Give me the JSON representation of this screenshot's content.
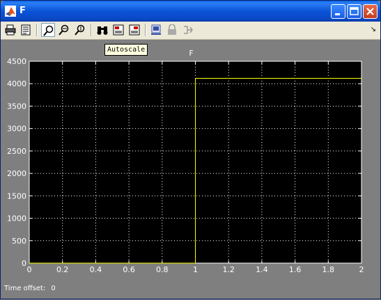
{
  "window": {
    "title": "F"
  },
  "toolbar": {
    "tooltip": "Autoscale",
    "buttons": [
      "print-icon",
      "parameters-icon",
      "zoom-icon",
      "zoom-x-icon",
      "zoom-y-icon",
      "autoscale-icon",
      "save-axes-icon",
      "restore-axes-icon",
      "float-icon",
      "lock-icon",
      "signal-selection-icon"
    ]
  },
  "chart_data": {
    "type": "line",
    "title": "F",
    "xlabel": "",
    "ylabel": "",
    "xlim": [
      0,
      2
    ],
    "ylim": [
      0,
      4500
    ],
    "x_ticks": [
      "0",
      "0.2",
      "0.4",
      "0.6",
      "0.8",
      "1",
      "1.2",
      "1.4",
      "1.6",
      "1.8",
      "2"
    ],
    "y_ticks": [
      "0",
      "500",
      "1000",
      "1500",
      "2000",
      "2500",
      "3000",
      "3500",
      "4000",
      "4500"
    ],
    "grid": true,
    "series": [
      {
        "x": [
          0,
          1,
          1,
          2
        ],
        "y": [
          0,
          0,
          4120,
          4120
        ],
        "color": "#ffff00"
      }
    ],
    "colors": {
      "axes_background": "#000000",
      "figure_background": "#7f7f7f",
      "grid": "#ffffff",
      "text": "#ffffff"
    }
  },
  "status": {
    "label": "Time offset:",
    "value": "0"
  }
}
